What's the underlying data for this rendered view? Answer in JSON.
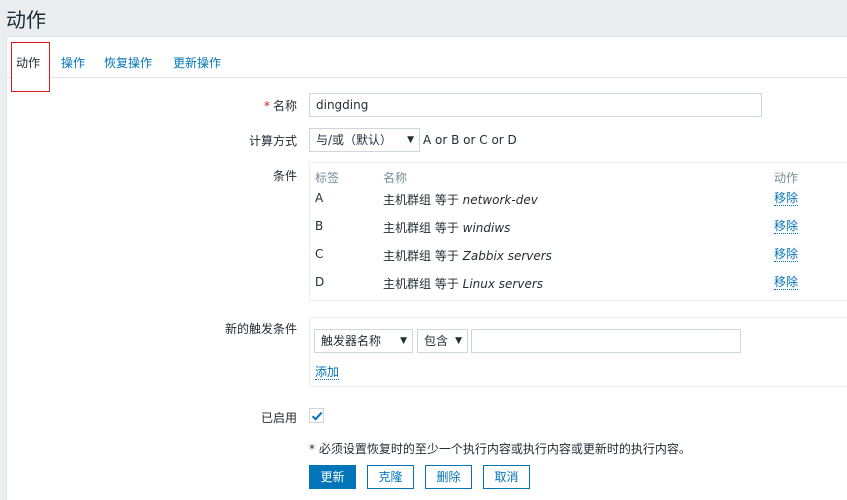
{
  "page": {
    "title": "动作"
  },
  "tabs": [
    {
      "label": "动作",
      "active": true
    },
    {
      "label": "操作",
      "active": false
    },
    {
      "label": "恢复操作",
      "active": false
    },
    {
      "label": "更新操作",
      "active": false
    }
  ],
  "form": {
    "name": {
      "required_mark": "*",
      "label": "名称",
      "value": "dingding"
    },
    "calc": {
      "label": "计算方式",
      "selected": "与/或（默认）",
      "formula": "A or B or C or D"
    },
    "conditions": {
      "label": "条件",
      "headers": {
        "tag": "标签",
        "name": "名称",
        "action": "动作"
      },
      "rows": [
        {
          "tag": "A",
          "prefix": "主机群组 等于 ",
          "value": "network-dev",
          "action": "移除"
        },
        {
          "tag": "B",
          "prefix": "主机群组 等于 ",
          "value": "windiws",
          "action": "移除"
        },
        {
          "tag": "C",
          "prefix": "主机群组 等于 ",
          "value": "Zabbix servers",
          "action": "移除"
        },
        {
          "tag": "D",
          "prefix": "主机群组 等于 ",
          "value": "Linux servers",
          "action": "移除"
        }
      ]
    },
    "new_condition": {
      "label": "新的触发条件",
      "type_selected": "触发器名称",
      "operator_selected": "包含",
      "value": "",
      "add_link": "添加"
    },
    "enabled": {
      "label": "已启用",
      "checked": true
    },
    "note": "* 必须设置恢复时的至少一个执行内容或执行内容或更新时的执行内容。"
  },
  "buttons": {
    "update": "更新",
    "clone": "克隆",
    "delete": "删除",
    "cancel": "取消"
  },
  "colors": {
    "accent": "#0275b8",
    "required": "#e0191a",
    "highlight_border": "#e0191a"
  }
}
